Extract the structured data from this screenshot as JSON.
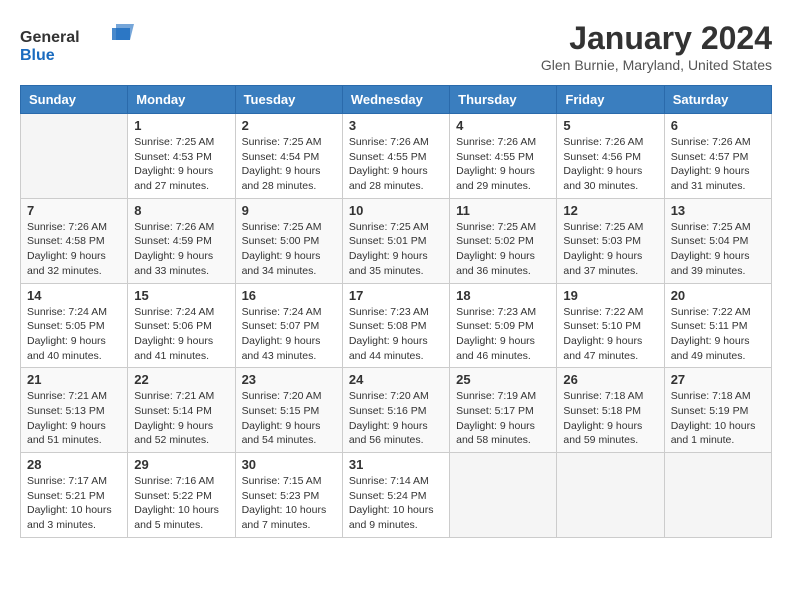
{
  "logo": {
    "general": "General",
    "blue": "Blue"
  },
  "header": {
    "month": "January 2024",
    "location": "Glen Burnie, Maryland, United States"
  },
  "weekdays": [
    "Sunday",
    "Monday",
    "Tuesday",
    "Wednesday",
    "Thursday",
    "Friday",
    "Saturday"
  ],
  "weeks": [
    [
      {
        "day": "",
        "info": ""
      },
      {
        "day": "1",
        "info": "Sunrise: 7:25 AM\nSunset: 4:53 PM\nDaylight: 9 hours\nand 27 minutes."
      },
      {
        "day": "2",
        "info": "Sunrise: 7:25 AM\nSunset: 4:54 PM\nDaylight: 9 hours\nand 28 minutes."
      },
      {
        "day": "3",
        "info": "Sunrise: 7:26 AM\nSunset: 4:55 PM\nDaylight: 9 hours\nand 28 minutes."
      },
      {
        "day": "4",
        "info": "Sunrise: 7:26 AM\nSunset: 4:55 PM\nDaylight: 9 hours\nand 29 minutes."
      },
      {
        "day": "5",
        "info": "Sunrise: 7:26 AM\nSunset: 4:56 PM\nDaylight: 9 hours\nand 30 minutes."
      },
      {
        "day": "6",
        "info": "Sunrise: 7:26 AM\nSunset: 4:57 PM\nDaylight: 9 hours\nand 31 minutes."
      }
    ],
    [
      {
        "day": "7",
        "info": "Sunrise: 7:26 AM\nSunset: 4:58 PM\nDaylight: 9 hours\nand 32 minutes."
      },
      {
        "day": "8",
        "info": "Sunrise: 7:26 AM\nSunset: 4:59 PM\nDaylight: 9 hours\nand 33 minutes."
      },
      {
        "day": "9",
        "info": "Sunrise: 7:25 AM\nSunset: 5:00 PM\nDaylight: 9 hours\nand 34 minutes."
      },
      {
        "day": "10",
        "info": "Sunrise: 7:25 AM\nSunset: 5:01 PM\nDaylight: 9 hours\nand 35 minutes."
      },
      {
        "day": "11",
        "info": "Sunrise: 7:25 AM\nSunset: 5:02 PM\nDaylight: 9 hours\nand 36 minutes."
      },
      {
        "day": "12",
        "info": "Sunrise: 7:25 AM\nSunset: 5:03 PM\nDaylight: 9 hours\nand 37 minutes."
      },
      {
        "day": "13",
        "info": "Sunrise: 7:25 AM\nSunset: 5:04 PM\nDaylight: 9 hours\nand 39 minutes."
      }
    ],
    [
      {
        "day": "14",
        "info": "Sunrise: 7:24 AM\nSunset: 5:05 PM\nDaylight: 9 hours\nand 40 minutes."
      },
      {
        "day": "15",
        "info": "Sunrise: 7:24 AM\nSunset: 5:06 PM\nDaylight: 9 hours\nand 41 minutes."
      },
      {
        "day": "16",
        "info": "Sunrise: 7:24 AM\nSunset: 5:07 PM\nDaylight: 9 hours\nand 43 minutes."
      },
      {
        "day": "17",
        "info": "Sunrise: 7:23 AM\nSunset: 5:08 PM\nDaylight: 9 hours\nand 44 minutes."
      },
      {
        "day": "18",
        "info": "Sunrise: 7:23 AM\nSunset: 5:09 PM\nDaylight: 9 hours\nand 46 minutes."
      },
      {
        "day": "19",
        "info": "Sunrise: 7:22 AM\nSunset: 5:10 PM\nDaylight: 9 hours\nand 47 minutes."
      },
      {
        "day": "20",
        "info": "Sunrise: 7:22 AM\nSunset: 5:11 PM\nDaylight: 9 hours\nand 49 minutes."
      }
    ],
    [
      {
        "day": "21",
        "info": "Sunrise: 7:21 AM\nSunset: 5:13 PM\nDaylight: 9 hours\nand 51 minutes."
      },
      {
        "day": "22",
        "info": "Sunrise: 7:21 AM\nSunset: 5:14 PM\nDaylight: 9 hours\nand 52 minutes."
      },
      {
        "day": "23",
        "info": "Sunrise: 7:20 AM\nSunset: 5:15 PM\nDaylight: 9 hours\nand 54 minutes."
      },
      {
        "day": "24",
        "info": "Sunrise: 7:20 AM\nSunset: 5:16 PM\nDaylight: 9 hours\nand 56 minutes."
      },
      {
        "day": "25",
        "info": "Sunrise: 7:19 AM\nSunset: 5:17 PM\nDaylight: 9 hours\nand 58 minutes."
      },
      {
        "day": "26",
        "info": "Sunrise: 7:18 AM\nSunset: 5:18 PM\nDaylight: 9 hours\nand 59 minutes."
      },
      {
        "day": "27",
        "info": "Sunrise: 7:18 AM\nSunset: 5:19 PM\nDaylight: 10 hours\nand 1 minute."
      }
    ],
    [
      {
        "day": "28",
        "info": "Sunrise: 7:17 AM\nSunset: 5:21 PM\nDaylight: 10 hours\nand 3 minutes."
      },
      {
        "day": "29",
        "info": "Sunrise: 7:16 AM\nSunset: 5:22 PM\nDaylight: 10 hours\nand 5 minutes."
      },
      {
        "day": "30",
        "info": "Sunrise: 7:15 AM\nSunset: 5:23 PM\nDaylight: 10 hours\nand 7 minutes."
      },
      {
        "day": "31",
        "info": "Sunrise: 7:14 AM\nSunset: 5:24 PM\nDaylight: 10 hours\nand 9 minutes."
      },
      {
        "day": "",
        "info": ""
      },
      {
        "day": "",
        "info": ""
      },
      {
        "day": "",
        "info": ""
      }
    ]
  ]
}
